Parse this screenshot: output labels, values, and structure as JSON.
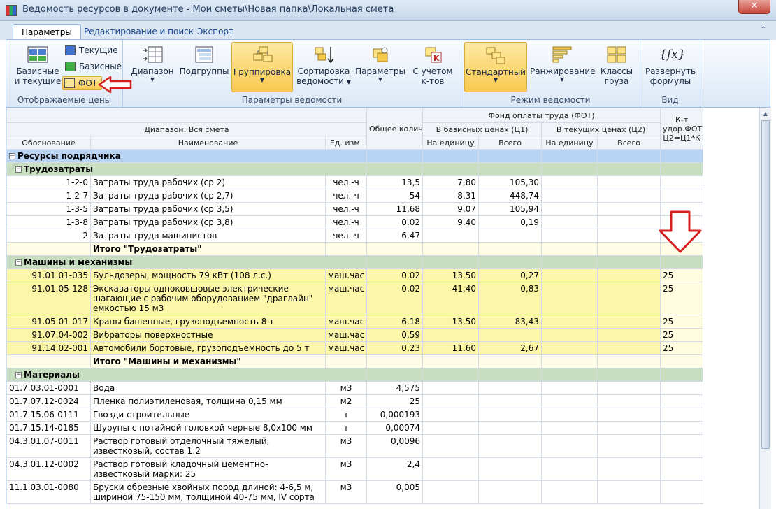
{
  "window": {
    "title": "Ведомость ресурсов в документе - Мои сметы\\Новая папка\\Локальная смета",
    "close_label": "✕"
  },
  "tabs": [
    {
      "label": "Параметры",
      "active": true
    },
    {
      "label": "Редактирование и поиск",
      "active": false
    },
    {
      "label": "Экспорт",
      "active": false
    }
  ],
  "ribbon": {
    "prices_group": {
      "label": "Отображаемые цены",
      "base_current": "Базисные и текущие",
      "base_current_l1": "Базисные",
      "base_current_l2": "и текущие",
      "current": "Текущие",
      "base": "Базисные",
      "fot": "ФОТ"
    },
    "params_group": {
      "label": "Параметры ведомости",
      "range": "Диапазон",
      "subgroups": "Подгруппы",
      "grouping": "Группировка",
      "sort_l1": "Сортировка",
      "sort_l2": "ведомости",
      "params": "Параметры",
      "coef_l1": "С учетом",
      "coef_l2": "к-тов"
    },
    "mode_group": {
      "label": "Режим ведомости",
      "standard": "Стандартный",
      "ranking": "Ранжирование",
      "classes_l1": "Классы",
      "classes_l2": "груза"
    },
    "view_group": {
      "label": "Вид",
      "expand_l1": "Развернуть",
      "expand_l2": "формулы",
      "icon_text": "{fx}"
    }
  },
  "grid": {
    "headers": {
      "range": "Диапазон: Вся смета",
      "basis": "Обоснование",
      "name": "Наименование",
      "unit": "Ед. изм.",
      "qty": "Общее количество",
      "fot": "Фонд оплаты труда (ФОТ)",
      "base_prices": "В базисных ценах (Ц1)",
      "current_prices": "В текущих ценах (Ц2)",
      "per_unit": "На единицу",
      "total": "Всего",
      "per_unit2": "На единицу",
      "total2": "Всего",
      "coef": "К-т удор.ФОТ Ц2=Ц1*К"
    },
    "group_contractor": "Ресурсы подрядчика",
    "group_labor": "Трудозатраты",
    "labor_rows": [
      {
        "code": "1-2-0",
        "name": "Затраты труда рабочих (ср 2)",
        "unit": "чел.-ч",
        "qty": "13,5",
        "per_unit": "7,80",
        "total": "105,30"
      },
      {
        "code": "1-2-7",
        "name": "Затраты труда рабочих (ср 2,7)",
        "unit": "чел.-ч",
        "qty": "54",
        "per_unit": "8,31",
        "total": "448,74"
      },
      {
        "code": "1-3-5",
        "name": "Затраты труда рабочих (ср 3,5)",
        "unit": "чел.-ч",
        "qty": "11,68",
        "per_unit": "9,07",
        "total": "105,94"
      },
      {
        "code": "1-3-8",
        "name": "Затраты труда рабочих (ср 3,8)",
        "unit": "чел.-ч",
        "qty": "0,02",
        "per_unit": "9,40",
        "total": "0,19"
      },
      {
        "code": "2",
        "name": "Затраты труда машинистов",
        "unit": "чел.-ч",
        "qty": "6,47",
        "per_unit": "",
        "total": ""
      }
    ],
    "total_labor": "Итого \"Трудозатраты\"",
    "group_machines": "Машины и механизмы",
    "machine_rows": [
      {
        "code": "91.01.01-035",
        "name": "Бульдозеры, мощность 79 кВт (108 л.с.)",
        "unit": "маш.час",
        "qty": "0,02",
        "per_unit": "13,50",
        "total": "0,27",
        "coef": "25"
      },
      {
        "code": "91.01.05-128",
        "name": "Экскаваторы одноковшовые электрические шагающие с рабочим оборудованием \"драглайн\" емкостью 15 м3",
        "unit": "маш.час",
        "qty": "0,02",
        "per_unit": "41,40",
        "total": "0,83",
        "coef": "25"
      },
      {
        "code": "91.05.01-017",
        "name": "Краны башенные, грузоподъемность 8 т",
        "unit": "маш.час",
        "qty": "6,18",
        "per_unit": "13,50",
        "total": "83,43",
        "coef": "25"
      },
      {
        "code": "91.07.04-002",
        "name": "Вибраторы поверхностные",
        "unit": "маш.час",
        "qty": "0,59",
        "per_unit": "",
        "total": "",
        "coef": "25"
      },
      {
        "code": "91.14.02-001",
        "name": "Автомобили бортовые, грузоподъемность до 5 т",
        "unit": "маш.час",
        "qty": "0,23",
        "per_unit": "11,60",
        "total": "2,67",
        "coef": "25"
      }
    ],
    "total_machines": "Итого \"Машины и механизмы\"",
    "group_materials": "Материалы",
    "material_rows": [
      {
        "code": "01.7.03.01-0001",
        "name": "Вода",
        "unit": "м3",
        "qty": "4,575"
      },
      {
        "code": "01.7.07.12-0024",
        "name": "Пленка полиэтиленовая, толщина 0,15 мм",
        "unit": "м2",
        "qty": "25"
      },
      {
        "code": "01.7.15.06-0111",
        "name": "Гвозди строительные",
        "unit": "т",
        "qty": "0,000193"
      },
      {
        "code": "01.7.15.14-0185",
        "name": "Шурупы с потайной головкой черные 8,0х100 мм",
        "unit": "т",
        "qty": "0,00074"
      },
      {
        "code": "04.3.01.07-0011",
        "name": "Раствор готовый отделочный тяжелый, известковый, состав 1:2",
        "unit": "м3",
        "qty": "0,0096"
      },
      {
        "code": "04.3.01.12-0002",
        "name": "Раствор готовый кладочный цементно-известковый марки: 25",
        "unit": "м3",
        "qty": "2,4"
      },
      {
        "code": "11.1.03.01-0080",
        "name": "Бруски обрезные хвойных пород длиной: 4-6,5 м, шириной 75-150 мм, толщиной 40-75 мм, IV сорта",
        "unit": "м3",
        "qty": "0,005"
      }
    ]
  }
}
